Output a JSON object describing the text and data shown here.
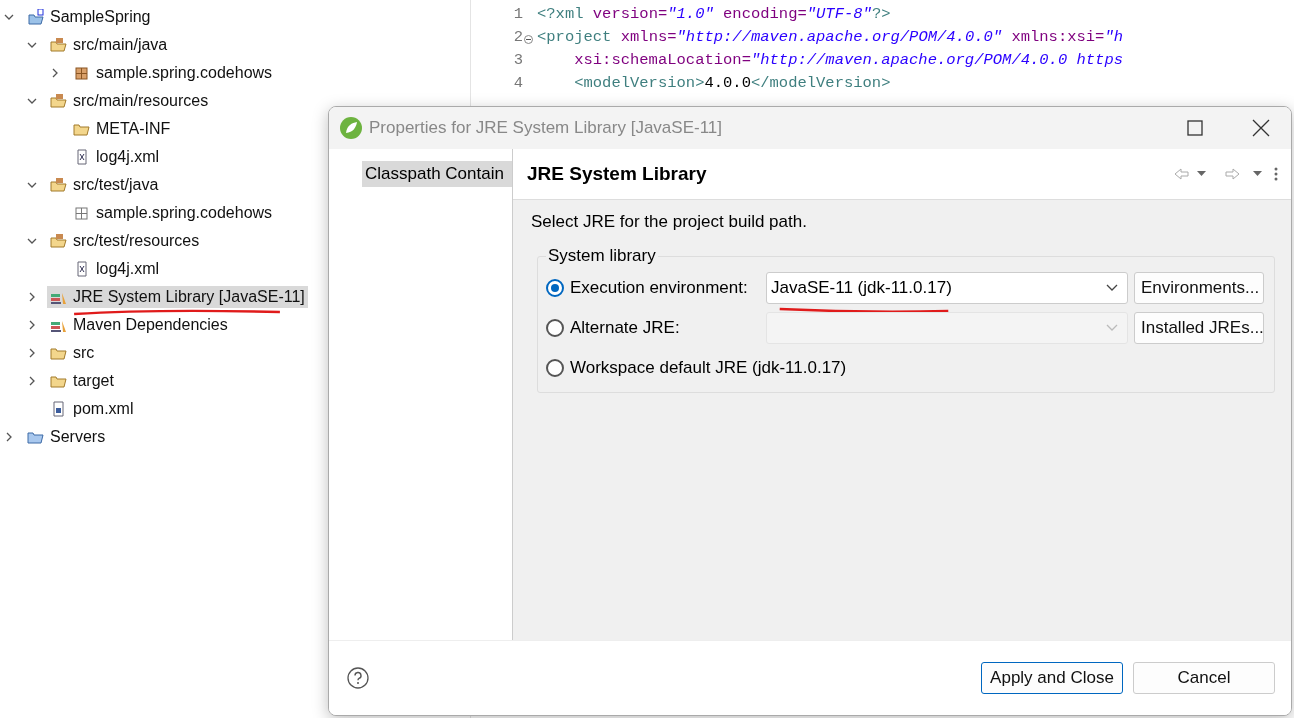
{
  "tree": [
    {
      "label": "SampleSpring",
      "kind": "project",
      "expanded": true,
      "selected": false,
      "children": [
        {
          "label": "src/main/java",
          "kind": "source-folder",
          "expanded": true,
          "selected": false,
          "children": [
            {
              "label": "sample.spring.codehows",
              "kind": "package",
              "expanded": false,
              "selected": false
            }
          ]
        },
        {
          "label": "src/main/resources",
          "kind": "source-folder",
          "expanded": true,
          "selected": false,
          "children": [
            {
              "label": "META-INF",
              "kind": "folder",
              "selected": false
            },
            {
              "label": "log4j.xml",
              "kind": "xml-file",
              "selected": false
            }
          ]
        },
        {
          "label": "src/test/java",
          "kind": "source-folder",
          "expanded": true,
          "selected": false,
          "children": [
            {
              "label": "sample.spring.codehows",
              "kind": "empty-package",
              "selected": false
            }
          ]
        },
        {
          "label": "src/test/resources",
          "kind": "source-folder",
          "expanded": true,
          "selected": false,
          "children": [
            {
              "label": "log4j.xml",
              "kind": "xml-file",
              "selected": false
            }
          ]
        },
        {
          "label": "JRE System Library [JavaSE-11]",
          "kind": "library",
          "expanded": false,
          "selected": true,
          "underlined": true
        },
        {
          "label": "Maven Dependencies",
          "kind": "library",
          "expanded": false,
          "selected": false
        },
        {
          "label": "src",
          "kind": "folder",
          "expanded": false,
          "selected": false
        },
        {
          "label": "target",
          "kind": "folder",
          "expanded": false,
          "selected": false
        },
        {
          "label": "pom.xml",
          "kind": "pom-file",
          "selected": false
        }
      ]
    },
    {
      "label": "Servers",
      "kind": "servers-folder",
      "expanded": false,
      "selected": false
    }
  ],
  "editor": {
    "lines": [
      {
        "number": "1",
        "tokens": [
          {
            "kind": "tag",
            "text": "<?xml"
          },
          {
            "kind": "attr",
            "text": " version="
          },
          {
            "kind": "string",
            "text": "\"1.0\""
          },
          {
            "kind": "attr",
            "text": " encoding="
          },
          {
            "kind": "string",
            "text": "\"UTF-8\""
          },
          {
            "kind": "tag",
            "text": "?>"
          }
        ]
      },
      {
        "number": "2",
        "folded": false,
        "tokens": [
          {
            "kind": "tag",
            "text": "<project"
          },
          {
            "kind": "attr",
            "text": " xmlns="
          },
          {
            "kind": "string",
            "text": "\"http://maven.apache.org/POM/4.0.0\""
          },
          {
            "kind": "attr",
            "text": " xmlns:xsi="
          },
          {
            "kind": "string",
            "text": "\"h"
          }
        ]
      },
      {
        "number": "3",
        "tokens": [
          {
            "kind": "attr",
            "text": "    xsi:schemaLocation="
          },
          {
            "kind": "string",
            "text": "\"http://maven.apache.org/POM/4.0.0 https"
          }
        ]
      },
      {
        "number": "4",
        "tokens": [
          {
            "kind": "tag",
            "text": "    <modelVersion>"
          },
          {
            "kind": "text",
            "text": "4.0.0"
          },
          {
            "kind": "tag",
            "text": "</modelVersion>"
          }
        ]
      }
    ]
  },
  "dialog": {
    "title": "Properties for JRE System Library [JavaSE-11]",
    "sidebar": [
      {
        "label": "Classpath Contain",
        "selected": true
      }
    ],
    "page_title": "JRE System Library",
    "description": "Select JRE for the project build path.",
    "group": {
      "title": "System library",
      "options": [
        {
          "kind": "combo",
          "label": "Execution environment:",
          "selected": true,
          "value": "JavaSE-11 (jdk-11.0.17)",
          "disabled": false,
          "underlined": true,
          "button": "Environments..."
        },
        {
          "kind": "combo",
          "label": "Alternate JRE:",
          "selected": false,
          "disabled": true,
          "button": "Installed JREs..."
        },
        {
          "kind": "plain",
          "label": "Workspace default JRE (jdk-11.0.17)",
          "selected": false
        }
      ]
    },
    "buttons": [
      {
        "label": "Apply and Close",
        "default": true
      },
      {
        "label": "Cancel",
        "default": false
      }
    ]
  }
}
